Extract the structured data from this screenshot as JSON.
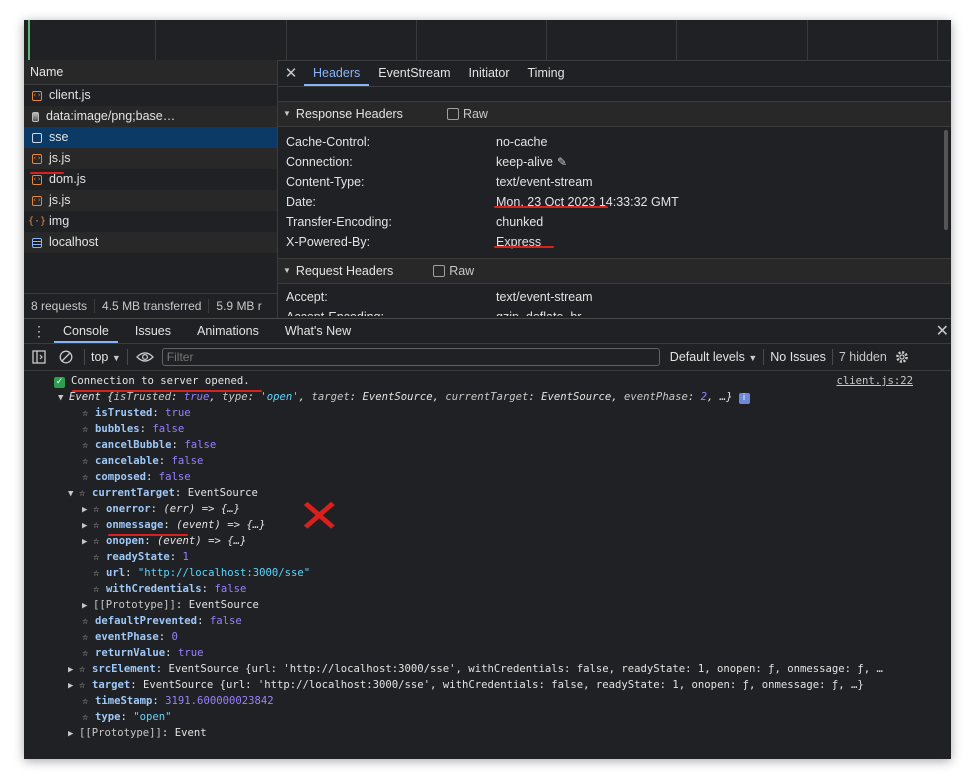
{
  "network": {
    "name_header": "Name",
    "requests": [
      {
        "name": "client.js",
        "icon": "script-icon"
      },
      {
        "name": "data:image/png;base…",
        "icon": "image-icon"
      },
      {
        "name": "sse",
        "icon": "document-icon"
      },
      {
        "name": "js.js",
        "icon": "script-icon"
      },
      {
        "name": "dom.js",
        "icon": "script-icon"
      },
      {
        "name": "js.js",
        "icon": "script-icon"
      },
      {
        "name": "img",
        "icon": "image-bracket-icon"
      },
      {
        "name": "localhost",
        "icon": "page-icon"
      }
    ],
    "status": {
      "requests": "8 requests",
      "transferred": "4.5 MB transferred",
      "resources": "5.9 MB r"
    }
  },
  "detail": {
    "close": "✕",
    "tabs": [
      "Headers",
      "EventStream",
      "Initiator",
      "Timing"
    ],
    "response_headers_title": "Response Headers",
    "raw_label": "Raw",
    "response_headers": [
      {
        "key": "Cache-Control:",
        "value": "no-cache"
      },
      {
        "key": "Connection:",
        "value": "keep-alive"
      },
      {
        "key": "Content-Type:",
        "value": "text/event-stream"
      },
      {
        "key": "Date:",
        "value": "Mon, 23 Oct 2023 14:33:32 GMT"
      },
      {
        "key": "Transfer-Encoding:",
        "value": "chunked"
      },
      {
        "key": "X-Powered-By:",
        "value": "Express"
      }
    ],
    "request_headers_title": "Request Headers",
    "request_headers": [
      {
        "key": "Accept:",
        "value": "text/event-stream"
      },
      {
        "key": "Accept-Encoding:",
        "value": "gzip, deflate, br"
      }
    ]
  },
  "drawer": {
    "tabs": [
      "Console",
      "Issues",
      "Animations",
      "What's New"
    ],
    "toolbar": {
      "context": "top",
      "filter_placeholder": "Filter",
      "levels": "Default levels",
      "issues": "No Issues",
      "hidden": "7 hidden"
    }
  },
  "console": {
    "source": "client.js:22",
    "message": "Connection to server opened.",
    "event_summary": {
      "head": "Event {",
      "k1": "isTrusted",
      "v1": "true",
      "k2": "type",
      "v2": "'open'",
      "k3": "target",
      "v3": "EventSource",
      "k4": "currentTarget",
      "v4": "EventSource",
      "k5": "eventPhase",
      "v5": "2",
      "tail": ", …}"
    },
    "props": {
      "isTrusted": {
        "k": "isTrusted",
        "v": "true"
      },
      "bubbles": {
        "k": "bubbles",
        "v": "false"
      },
      "cancelBubble": {
        "k": "cancelBubble",
        "v": "false"
      },
      "cancelable": {
        "k": "cancelable",
        "v": "false"
      },
      "composed": {
        "k": "composed",
        "v": "false"
      },
      "currentTarget": {
        "k": "currentTarget",
        "v": "EventSource"
      },
      "onerror": {
        "k": "onerror",
        "v": "(err) => {…}"
      },
      "onmessage": {
        "k": "onmessage",
        "v": "(event) => {…}"
      },
      "onopen": {
        "k": "onopen",
        "v": "(event) => {…}"
      },
      "readyState": {
        "k": "readyState",
        "v": "1"
      },
      "url": {
        "k": "url",
        "v": "\"http://localhost:3000/sse\""
      },
      "withCredentials": {
        "k": "withCredentials",
        "v": "false"
      },
      "prototype1": {
        "k": "[[Prototype]]",
        "v": "EventSource"
      },
      "defaultPrevented": {
        "k": "defaultPrevented",
        "v": "false"
      },
      "eventPhase": {
        "k": "eventPhase",
        "v": "0"
      },
      "returnValue": {
        "k": "returnValue",
        "v": "true"
      },
      "srcElement": {
        "k": "srcElement",
        "v": "EventSource {url: 'http://localhost:3000/sse', withCredentials: false, readyState: 1, onopen: ƒ, onmessage: ƒ, …"
      },
      "target": {
        "k": "target",
        "v": "EventSource {url: 'http://localhost:3000/sse', withCredentials: false, readyState: 1, onopen: ƒ, onmessage: ƒ, …}"
      },
      "timeStamp": {
        "k": "timeStamp",
        "v": "3191.600000023842"
      },
      "type": {
        "k": "type",
        "v": "\"open\""
      },
      "prototype2": {
        "k": "[[Prototype]]",
        "v": "Event"
      }
    }
  },
  "annotation": {
    "mark": "✕"
  },
  "colors": {
    "accent": "#8ab4f8",
    "selected_row": "#0b3a66",
    "annotation": "#d8201c"
  }
}
